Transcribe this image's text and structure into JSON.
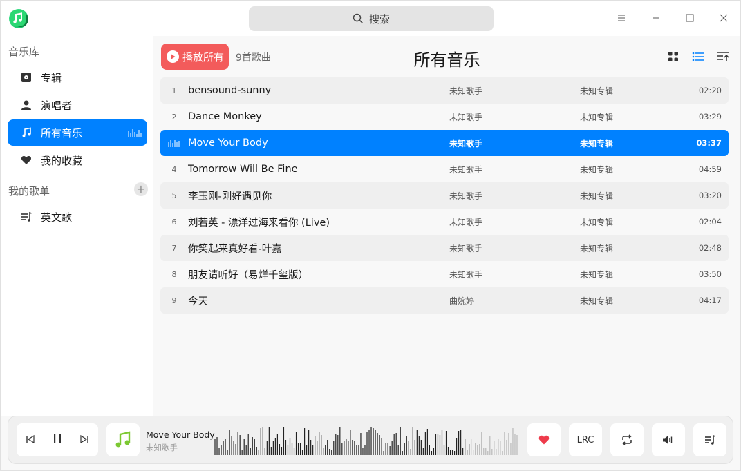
{
  "app": {
    "search_placeholder": "搜索"
  },
  "sidebar": {
    "library_label": "音乐库",
    "items": [
      {
        "label": "专辑",
        "icon": "album-icon"
      },
      {
        "label": "演唱者",
        "icon": "artist-icon"
      },
      {
        "label": "所有音乐",
        "icon": "music-note-icon",
        "active": true
      },
      {
        "label": "我的收藏",
        "icon": "heart-icon"
      }
    ],
    "playlists_label": "我的歌单",
    "add_label": "+",
    "playlists": [
      {
        "label": "英文歌",
        "icon": "playlist-icon"
      }
    ]
  },
  "main": {
    "play_all_label": "播放所有",
    "count_label": "9首歌曲",
    "title": "所有音乐",
    "songs": [
      {
        "num": "1",
        "title": "bensound-sunny",
        "artist": "未知歌手",
        "album": "未知专辑",
        "duration": "02:20"
      },
      {
        "num": "2",
        "title": "Dance Monkey",
        "artist": "未知歌手",
        "album": "未知专辑",
        "duration": "03:29"
      },
      {
        "num": "",
        "title": "Move Your Body",
        "artist": "未知歌手",
        "album": "未知专辑",
        "duration": "03:37",
        "playing": true
      },
      {
        "num": "4",
        "title": "Tomorrow Will Be Fine",
        "artist": "未知歌手",
        "album": "未知专辑",
        "duration": "04:59"
      },
      {
        "num": "5",
        "title": "李玉刚-刚好遇见你",
        "artist": "未知歌手",
        "album": "未知专辑",
        "duration": "03:20"
      },
      {
        "num": "6",
        "title": "刘若英 - 漂洋过海来看你 (Live)",
        "artist": "未知歌手",
        "album": "未知专辑",
        "duration": "02:04"
      },
      {
        "num": "7",
        "title": "你笑起来真好看-叶嘉",
        "artist": "未知歌手",
        "album": "未知专辑",
        "duration": "02:48"
      },
      {
        "num": "8",
        "title": "朋友请听好（易烊千玺版）",
        "artist": "未知歌手",
        "album": "未知专辑",
        "duration": "03:50"
      },
      {
        "num": "9",
        "title": "今天",
        "artist": "曲婉婷",
        "album": "未知专辑",
        "duration": "04:17"
      }
    ]
  },
  "player": {
    "track_title": "Move Your Body",
    "track_artist": "未知歌手",
    "lrc_label": "LRC",
    "progress": 0.84,
    "favorited": true
  },
  "colors": {
    "accent": "#0081ff",
    "play_all": "#f35b5b",
    "heart": "#ee3b4b",
    "app_green": "#19c465"
  }
}
